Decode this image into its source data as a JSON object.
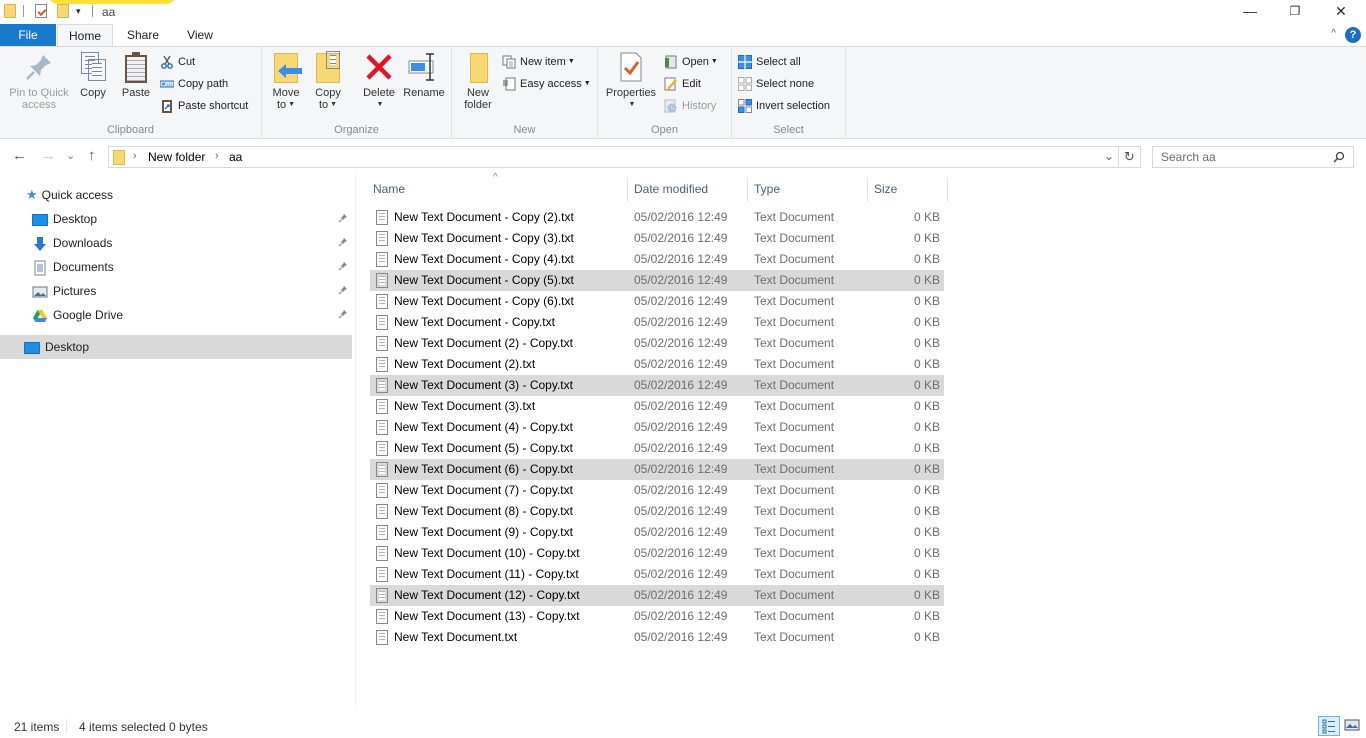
{
  "window": {
    "title": "aa",
    "controls": {
      "minimize": "—",
      "maximize": "❐",
      "close": "✕"
    }
  },
  "quick_access_toolbar": {
    "icons": [
      "folder-icon",
      "properties-icon",
      "new-folder-icon",
      "customize-dropdown-icon"
    ],
    "dropdown_glyph": "▾"
  },
  "tabs": [
    {
      "label": "File",
      "active": false
    },
    {
      "label": "Home",
      "active": true
    },
    {
      "label": "Share",
      "active": false
    },
    {
      "label": "View",
      "active": false
    }
  ],
  "ribbon_controls": {
    "collapse_glyph": "^",
    "help_glyph": "?"
  },
  "ribbon": {
    "clipboard": {
      "label": "Clipboard",
      "pin_to_quick_access": "Pin to Quick\naccess",
      "copy": "Copy",
      "paste": "Paste",
      "cut": "Cut",
      "copy_path": "Copy path",
      "paste_shortcut": "Paste shortcut"
    },
    "organize": {
      "label": "Organize",
      "move_to": "Move",
      "move_to_2": "to",
      "copy_to": "Copy",
      "copy_to_2": "to",
      "delete": "Delete",
      "rename": "Rename"
    },
    "new": {
      "label": "New",
      "new_folder": "New",
      "new_folder_2": "folder",
      "new_item": "New item",
      "easy_access": "Easy access"
    },
    "open": {
      "label": "Open",
      "properties": "Properties",
      "open": "Open",
      "edit": "Edit",
      "history": "History"
    },
    "select": {
      "label": "Select",
      "select_all": "Select all",
      "select_none": "Select none",
      "invert_selection": "Invert selection"
    }
  },
  "navigation": {
    "back": "←",
    "forward": "→",
    "recent": "⌄",
    "up": "↑",
    "breadcrumb": [
      "New folder",
      "aa"
    ],
    "separator": "›",
    "address_dropdown": "⌄",
    "refresh": "↻"
  },
  "search": {
    "placeholder": "Search aa",
    "value": ""
  },
  "nav_pane": {
    "quick_access_label": "Quick access",
    "quick_access_items": [
      {
        "label": "Desktop",
        "icon": "desktop-icon",
        "pinned": true
      },
      {
        "label": "Downloads",
        "icon": "downloads-icon",
        "pinned": true
      },
      {
        "label": "Documents",
        "icon": "documents-icon",
        "pinned": true
      },
      {
        "label": "Pictures",
        "icon": "pictures-icon",
        "pinned": true
      },
      {
        "label": "Google Drive",
        "icon": "google-drive-icon",
        "pinned": true
      }
    ],
    "root_items": [
      {
        "label": "Desktop",
        "icon": "desktop-icon",
        "selected": true
      }
    ]
  },
  "file_list": {
    "sort_indicator": "^",
    "columns": [
      "Name",
      "Date modified",
      "Type",
      "Size"
    ],
    "rows": [
      {
        "name": "New Text Document - Copy (2).txt",
        "date": "05/02/2016 12:49",
        "type": "Text Document",
        "size": "0 KB",
        "selected": false
      },
      {
        "name": "New Text Document - Copy (3).txt",
        "date": "05/02/2016 12:49",
        "type": "Text Document",
        "size": "0 KB",
        "selected": false
      },
      {
        "name": "New Text Document - Copy (4).txt",
        "date": "05/02/2016 12:49",
        "type": "Text Document",
        "size": "0 KB",
        "selected": false
      },
      {
        "name": "New Text Document - Copy (5).txt",
        "date": "05/02/2016 12:49",
        "type": "Text Document",
        "size": "0 KB",
        "selected": true
      },
      {
        "name": "New Text Document - Copy (6).txt",
        "date": "05/02/2016 12:49",
        "type": "Text Document",
        "size": "0 KB",
        "selected": false
      },
      {
        "name": "New Text Document - Copy.txt",
        "date": "05/02/2016 12:49",
        "type": "Text Document",
        "size": "0 KB",
        "selected": false
      },
      {
        "name": "New Text Document (2) - Copy.txt",
        "date": "05/02/2016 12:49",
        "type": "Text Document",
        "size": "0 KB",
        "selected": false
      },
      {
        "name": "New Text Document (2).txt",
        "date": "05/02/2016 12:49",
        "type": "Text Document",
        "size": "0 KB",
        "selected": false
      },
      {
        "name": "New Text Document (3) - Copy.txt",
        "date": "05/02/2016 12:49",
        "type": "Text Document",
        "size": "0 KB",
        "selected": true
      },
      {
        "name": "New Text Document (3).txt",
        "date": "05/02/2016 12:49",
        "type": "Text Document",
        "size": "0 KB",
        "selected": false
      },
      {
        "name": "New Text Document (4) - Copy.txt",
        "date": "05/02/2016 12:49",
        "type": "Text Document",
        "size": "0 KB",
        "selected": false
      },
      {
        "name": "New Text Document (5) - Copy.txt",
        "date": "05/02/2016 12:49",
        "type": "Text Document",
        "size": "0 KB",
        "selected": false
      },
      {
        "name": "New Text Document (6) - Copy.txt",
        "date": "05/02/2016 12:49",
        "type": "Text Document",
        "size": "0 KB",
        "selected": true
      },
      {
        "name": "New Text Document (7) - Copy.txt",
        "date": "05/02/2016 12:49",
        "type": "Text Document",
        "size": "0 KB",
        "selected": false
      },
      {
        "name": "New Text Document (8) - Copy.txt",
        "date": "05/02/2016 12:49",
        "type": "Text Document",
        "size": "0 KB",
        "selected": false
      },
      {
        "name": "New Text Document (9) - Copy.txt",
        "date": "05/02/2016 12:49",
        "type": "Text Document",
        "size": "0 KB",
        "selected": false
      },
      {
        "name": "New Text Document (10) - Copy.txt",
        "date": "05/02/2016 12:49",
        "type": "Text Document",
        "size": "0 KB",
        "selected": false
      },
      {
        "name": "New Text Document (11) - Copy.txt",
        "date": "05/02/2016 12:49",
        "type": "Text Document",
        "size": "0 KB",
        "selected": false
      },
      {
        "name": "New Text Document (12) - Copy.txt",
        "date": "05/02/2016 12:49",
        "type": "Text Document",
        "size": "0 KB",
        "selected": true
      },
      {
        "name": "New Text Document (13) - Copy.txt",
        "date": "05/02/2016 12:49",
        "type": "Text Document",
        "size": "0 KB",
        "selected": false
      },
      {
        "name": "New Text Document.txt",
        "date": "05/02/2016 12:49",
        "type": "Text Document",
        "size": "0 KB",
        "selected": false
      }
    ]
  },
  "status_bar": {
    "item_count": "21 items",
    "selection": "4 items selected",
    "selection_size": "0 bytes"
  },
  "colors": {
    "file_tab": "#1979ca",
    "selection": "#d9d9d9",
    "folder": "#f8d775",
    "accent_blue": "#1a6fc4",
    "delete_red": "#e81123"
  }
}
